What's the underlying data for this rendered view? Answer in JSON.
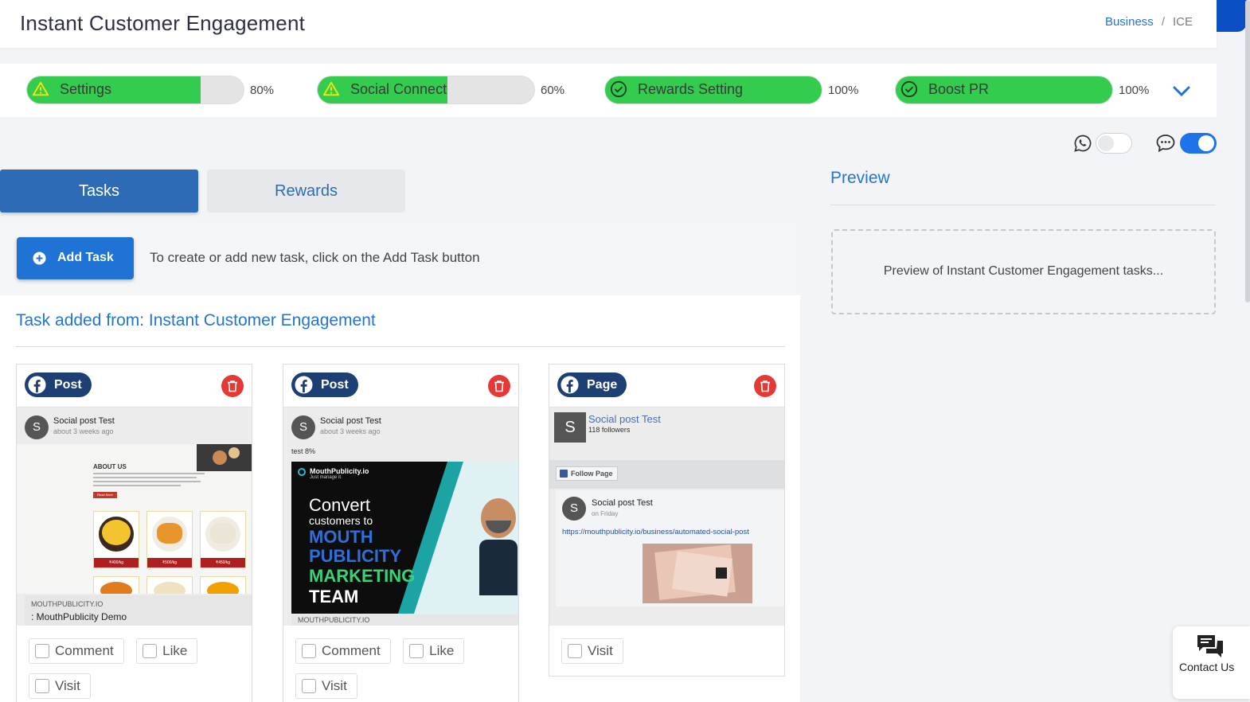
{
  "header": {
    "title": "Instant Customer Engagement",
    "breadcrumb": {
      "link": "Business",
      "separator": "/",
      "current": "ICE"
    }
  },
  "progress": [
    {
      "label": "Settings",
      "percent": 80,
      "percent_text": "80%",
      "icon": "warning-icon"
    },
    {
      "label": "Social Connect",
      "percent": 60,
      "percent_text": "60%",
      "icon": "warning-icon"
    },
    {
      "label": "Rewards Setting",
      "percent": 100,
      "percent_text": "100%",
      "icon": "check-circle-icon"
    },
    {
      "label": "Boost PR",
      "percent": 100,
      "percent_text": "100%",
      "icon": "check-circle-icon"
    }
  ],
  "channels": {
    "whatsapp_enabled": false,
    "sms_enabled": true
  },
  "tabs": [
    {
      "label": "Tasks",
      "active": true
    },
    {
      "label": "Rewards",
      "active": false
    }
  ],
  "add_task": {
    "button_label": "Add Task",
    "hint": "To create or add new task, click on the Add Task button"
  },
  "section_title": "Task added from: Instant Customer Engagement",
  "cards": [
    {
      "badge": "Post",
      "post_name": "Social post Test",
      "post_time": "about 3 weeks ago",
      "about_heading": "ABOUT US",
      "read_more": "Read More",
      "prices": [
        "₹400/kg",
        "₹500/kg",
        "₹450/kg"
      ],
      "link_domain": "MOUTHPUBLICITY.IO",
      "link_title": ": MouthPublicity Demo",
      "actions": [
        "Comment",
        "Like",
        "Visit"
      ]
    },
    {
      "badge": "Post",
      "post_name": "Social post Test",
      "post_time": "about 3 weeks ago",
      "caption": "test 8%",
      "brand": "MouthPublicity.io",
      "brand_tagline": "Just manage it.",
      "promo": [
        "Convert",
        "customers to",
        "MOUTH",
        "PUBLICITY",
        "MARKETING",
        "TEAM"
      ],
      "link_domain": "MOUTHPUBLICITY.IO",
      "actions": [
        "Comment",
        "Like",
        "Visit"
      ]
    },
    {
      "badge": "Page",
      "page_name": "Social post Test",
      "followers": "118 followers",
      "follow_label": "Follow Page",
      "post_name": "Social post Test",
      "post_time": "on Friday",
      "url": "https://mouthpublicity.io/business/automated-social-post",
      "actions": [
        "Visit"
      ]
    }
  ],
  "preview": {
    "title": "Preview",
    "placeholder": "Preview of Instant Customer Engagement tasks..."
  },
  "contact": {
    "label": "Contact Us"
  },
  "colors": {
    "primary": "#2d6cb5",
    "progress_fill": "#33cc4f",
    "accent_blue": "#1e73d4",
    "danger": "#e53935",
    "badge": "#1e3f74"
  }
}
